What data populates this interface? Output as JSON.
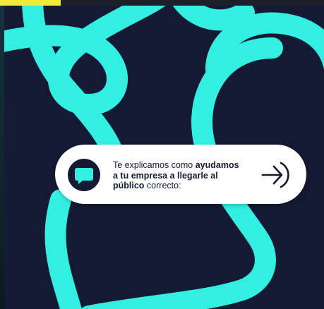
{
  "colors": {
    "background": "#141a33",
    "accent": "#33efe2",
    "highlight": "#f2ea3a",
    "pill": "#ffffff"
  },
  "callout": {
    "line1_normal": "Te explicamos como ",
    "line1_bold": "ayudamos",
    "line2_bold": "a tu empresa a llegarle al",
    "line3_bold": "público",
    "line3_normal": " correcto:"
  },
  "icons": {
    "bubble": "chat-bubble-icon",
    "arrow": "arrow-right-icon"
  }
}
